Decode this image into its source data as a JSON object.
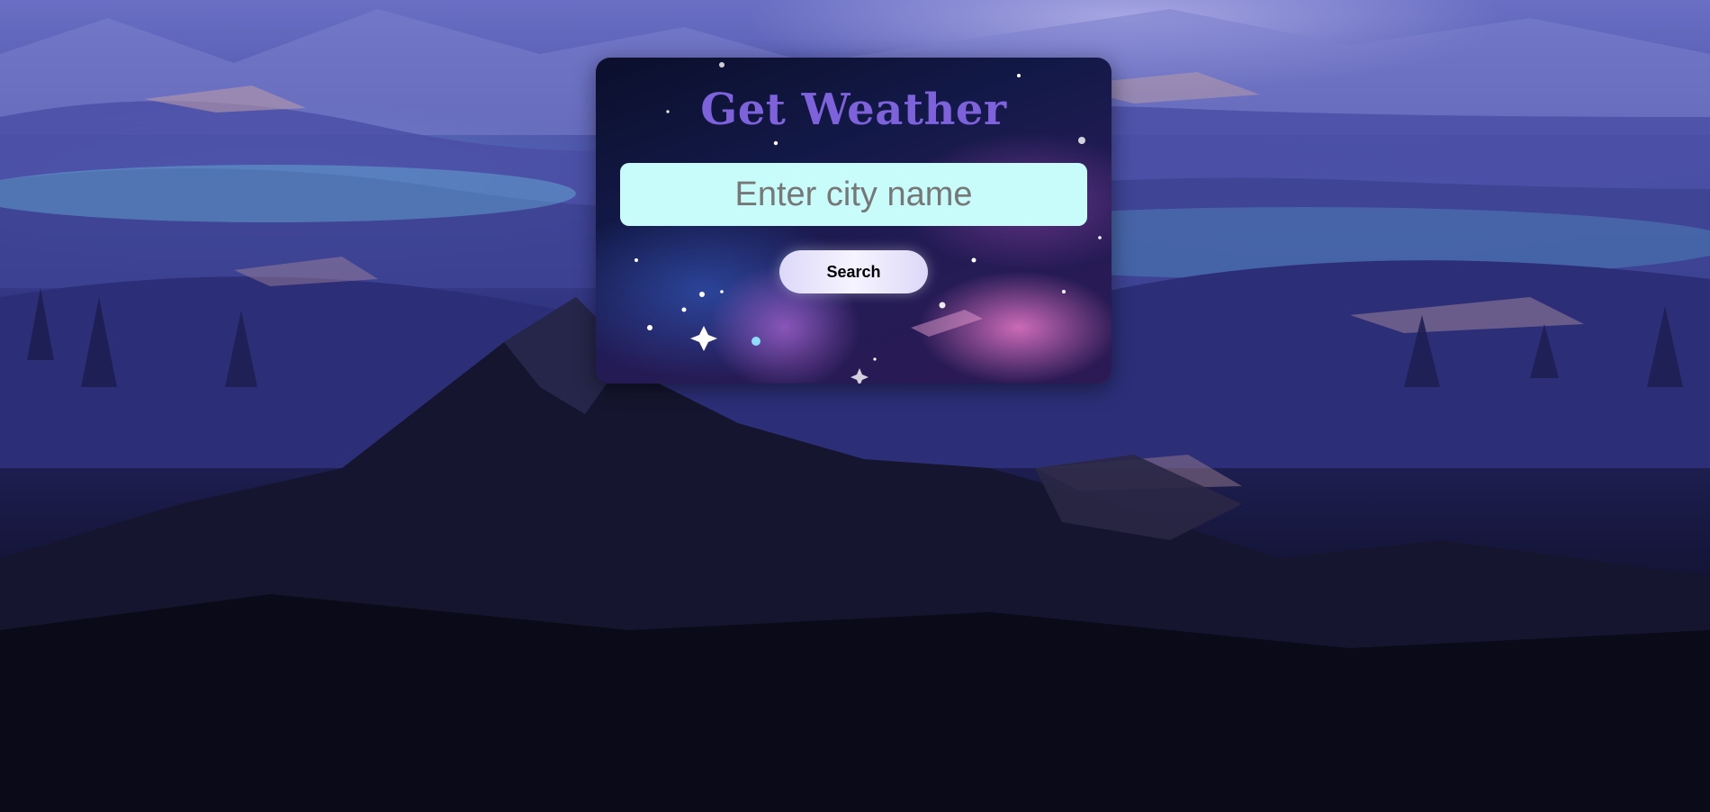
{
  "app": {
    "title": "Get Weather"
  },
  "search": {
    "placeholder": "Enter city name",
    "value": "",
    "button_label": "Search"
  },
  "colors": {
    "title": "#7d62dc",
    "input_background": "#c8fcfa",
    "button_background": "#f0eeff"
  },
  "background": {
    "description_icon": "mountain-landscape-illustration"
  }
}
